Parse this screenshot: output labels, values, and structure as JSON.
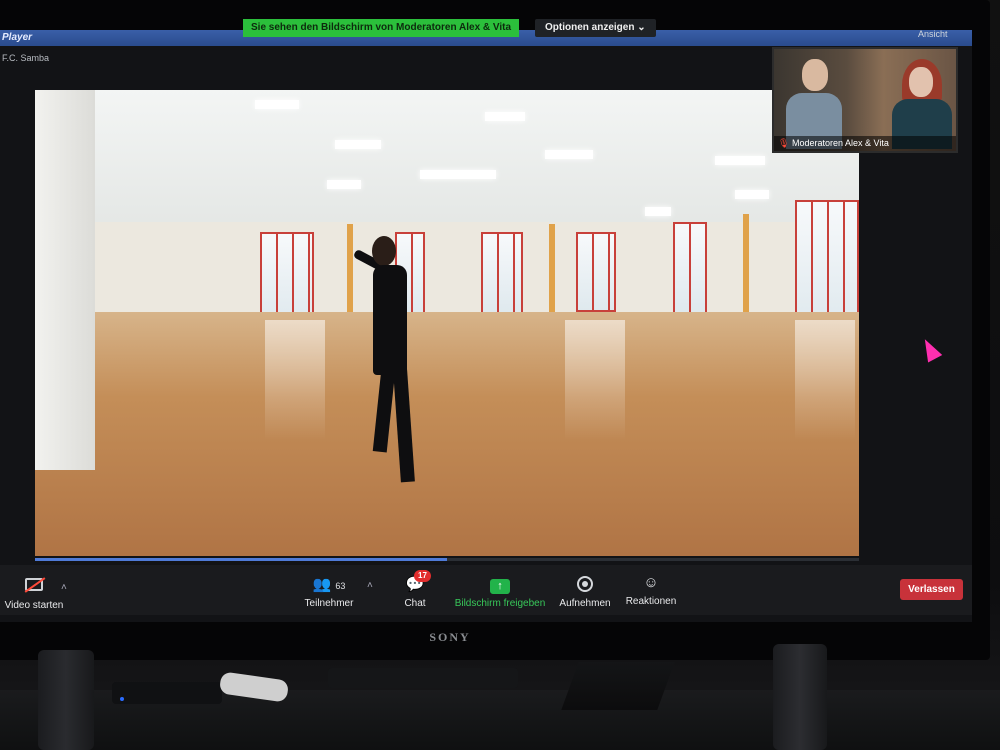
{
  "banner": {
    "share_text": "Sie sehen den Bildschirm von Moderatoren Alex & Vita",
    "options_label": "Optionen anzeigen",
    "view_label": "Ansicht"
  },
  "player": {
    "title": "Player",
    "subtitle": "F.C. Samba"
  },
  "participant_thumb": {
    "name": "Moderatoren Alex & Vita",
    "muted": true
  },
  "video_progress": 0.5,
  "toolbar": {
    "video_label": "Video starten",
    "participants_label": "Teilnehmer",
    "participants_count": "63",
    "chat_label": "Chat",
    "chat_badge": "17",
    "share_label": "Bildschirm freigeben",
    "record_label": "Aufnehmen",
    "reactions_label": "Reaktionen",
    "leave_label": "Verlassen"
  },
  "tv": {
    "brand": "SONY"
  },
  "colors": {
    "share_green": "#2bbf3b",
    "leave_red": "#c8323a",
    "badge_red": "#e22d2d",
    "cursor_pink": "#ff2fb0"
  },
  "icons": {
    "video": "video-off-icon",
    "participants": "participants-icon",
    "chat": "chat-bubble-icon",
    "share": "share-screen-arrow-icon",
    "record": "record-icon",
    "reactions": "emoji-plus-icon"
  }
}
